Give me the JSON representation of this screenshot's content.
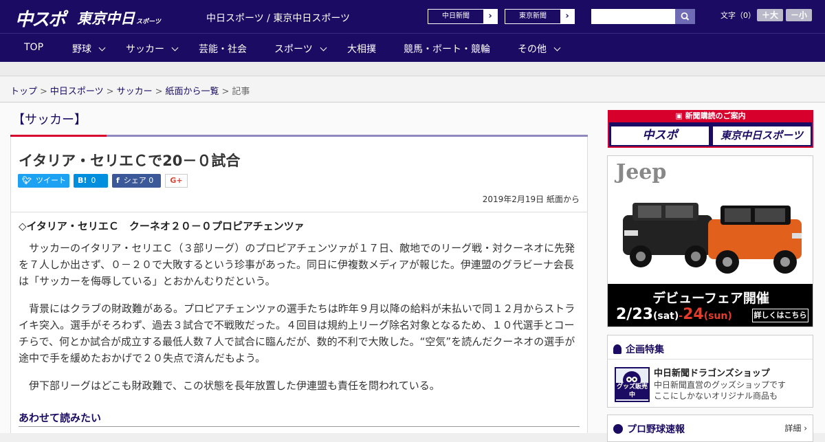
{
  "header": {
    "logo_chunichi": "中スポ",
    "logo_tokyo": "東京中日",
    "logo_tokyo_sub": "スポーツ",
    "site_title": "中日スポーツ / 東京中日スポーツ",
    "ext_links": [
      {
        "label": "中日新聞"
      },
      {
        "label": "東京新聞"
      }
    ],
    "search_placeholder": "",
    "font_size_label": "文字（0）",
    "font_larger": "＋大",
    "font_smaller": "－小"
  },
  "nav": {
    "items": [
      {
        "label": "TOP",
        "dropdown": false
      },
      {
        "label": "野球",
        "dropdown": true
      },
      {
        "label": "サッカー",
        "dropdown": true
      },
      {
        "label": "芸能・社会",
        "dropdown": false
      },
      {
        "label": "スポーツ",
        "dropdown": true
      },
      {
        "label": "大相撲",
        "dropdown": false
      },
      {
        "label": "競馬・ボート・競輪",
        "dropdown": false
      },
      {
        "label": "その他",
        "dropdown": true
      }
    ]
  },
  "breadcrumb": {
    "items": [
      "トップ",
      "中日スポーツ",
      "サッカー",
      "紙面から一覧"
    ],
    "current": "記事",
    "separator": ">"
  },
  "article": {
    "category": "【サッカー】",
    "title": "イタリア・セリエＣで20－０試合",
    "share": {
      "tweet": "ツイート",
      "hatena_icon": "B!",
      "hatena_count": "0",
      "facebook": "シェア",
      "facebook_count": "0",
      "gplus": "G+"
    },
    "date": "2019年2月19日 紙面から",
    "lead": "◇イタリア・セリエＣ　クーネオ２０－０プロピアチェンツァ",
    "paragraphs": [
      "　サッカーのイタリア・セリエＣ（３部リーグ）のプロピアチェンツァが１７日、敵地でのリーグ戦・対クーネオに先発を７人しか出さず、０－２０で大敗するという珍事があった。同日に伊複数メディアが報じた。伊連盟のグラビーナ会長は「サッカーを侮辱している」とおかんむりだという。",
      "　背景にはクラブの財政難がある。プロピアチェンツァの選手たちは昨年９月以降の給料が未払いで同１２月からストライキ突入。選手がそろわず、過去３試合で不戦敗だった。４回目は規約上リーグ除名対象となるため、１０代選手とコーチらで、何とか試合が成立する最低人数７人で試合に臨んだが、数的不利で大敗した。“空気”を読んだクーネオの選手が途中で手を緩めたおかげで２０失点で済んだもよう。",
      "　伊下部リーグはどこも財政難で、この状態を長年放置した伊連盟も責任を問われている。"
    ],
    "related_heading": "あわせて読みたい"
  },
  "sidebar": {
    "subscribe_head": "新聞購読のご案内",
    "subscribe_logos": [
      "中スポ",
      "東京中日スポーツ"
    ],
    "ad": {
      "brand": "Jeep",
      "fair": "デビューフェア開催",
      "date1": "2/23",
      "day1": "(sat)",
      "dash": "-",
      "date2": "24",
      "day2": "(sun)",
      "more": "詳しくはこちら"
    },
    "feature": {
      "heading": "企画特集",
      "thumb_label": "グッズ販売中",
      "title": "中日新聞ドラゴンズショップ",
      "desc1": "中日新聞直営のグッズショップです",
      "desc2": "ここにしかないオリジナル商品も"
    },
    "baseball": {
      "heading": "プロ野球速報",
      "detail": "詳細 ›"
    }
  },
  "colors": {
    "brand_navy": "#1b0b63",
    "accent_red": "#d7002c",
    "twitter": "#1da1f2",
    "hatena": "#008fde",
    "facebook": "#3b5998"
  }
}
